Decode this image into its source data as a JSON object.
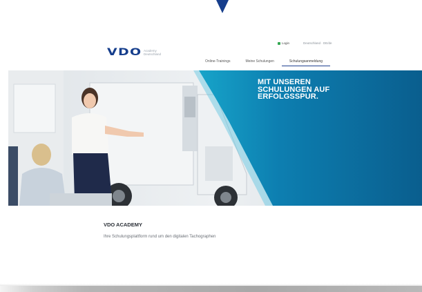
{
  "brand": {
    "logo_text": "VDO",
    "sub_line1": "Academy",
    "sub_line2": "Deutschland",
    "accent": "#163e8c"
  },
  "header": {
    "login_label": "Login",
    "locale_label": "Deutschland · DE/de"
  },
  "nav": {
    "items": [
      {
        "label": "Online-Trainings"
      },
      {
        "label": "Meine Schulungen"
      },
      {
        "label": "Schulungsanmeldung",
        "active": true
      }
    ]
  },
  "hero": {
    "lines": [
      "MIT UNSEREN",
      "SCHULUNGEN AUF",
      "ERFOLGSSPUR."
    ],
    "overlay_color": "#0a6ea3"
  },
  "content": {
    "title": "VDO ACADEMY",
    "subtitle": "Ihre Schulungsplattform rund um den digitalen Tachographen"
  }
}
